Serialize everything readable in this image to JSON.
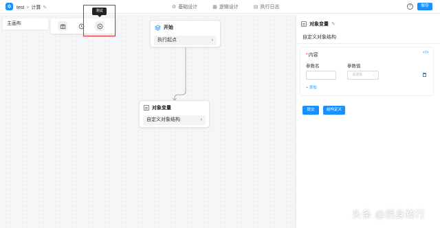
{
  "header": {
    "app_name": "test",
    "breadcrumb_sep": ">",
    "page_name": "计算",
    "tabs": [
      {
        "label": "基础设计"
      },
      {
        "label": "逻辑设计"
      },
      {
        "label": "执行日志"
      }
    ],
    "help_glyph": "?",
    "save_label": "保存"
  },
  "canvas": {
    "board_tab": "主画布",
    "toolbar": {
      "tooltip": "测试",
      "buttons": [
        "package-icon",
        "clock-icon",
        "play-icon"
      ]
    },
    "nodes": {
      "start": {
        "title": "开始",
        "row": "执行起点"
      },
      "variable": {
        "title": "对象变量",
        "row": "自定义对象结构"
      }
    }
  },
  "panel": {
    "title": "对象变量",
    "subtitle": "自定义对象结构",
    "section_label": "内容",
    "code_glyph": "</>",
    "columns": {
      "name": "参数名",
      "value": "参数值"
    },
    "value_placeholder": "请选择",
    "add_label": "+ 添加",
    "submit_label": "提交",
    "struct_label": "结构定义"
  },
  "watermark": "头条 @躬身践行",
  "colors": {
    "accent": "#1890ff",
    "highlight": "#e02020",
    "canvas_bg": "#f5f6f8"
  }
}
